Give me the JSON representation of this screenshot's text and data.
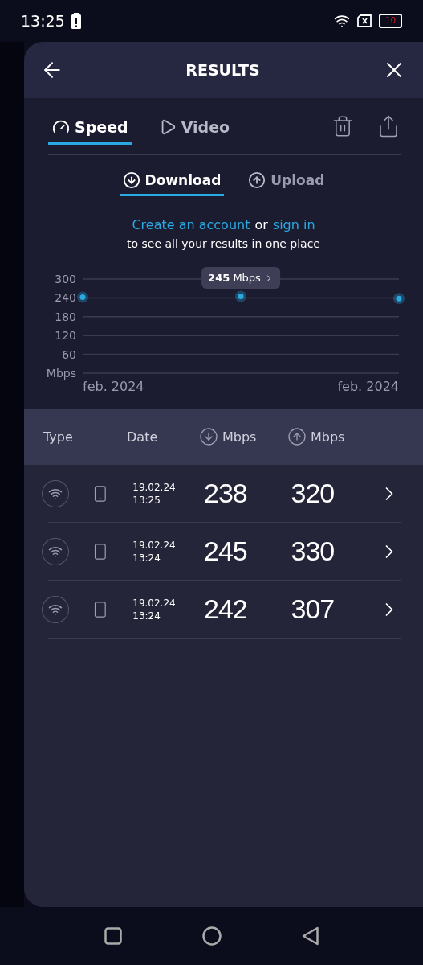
{
  "status_bar": {
    "time": "13:25",
    "battery": "10"
  },
  "header": {
    "title": "RESULTS"
  },
  "tabs": [
    {
      "label": "Speed",
      "kind": "speed",
      "selected": true
    },
    {
      "label": "Video",
      "kind": "video",
      "selected": false
    }
  ],
  "direction_tabs": [
    {
      "label": "Download",
      "kind": "download",
      "selected": true
    },
    {
      "label": "Upload",
      "kind": "upload",
      "selected": false
    }
  ],
  "account_prompt": {
    "create_link": "Create an account",
    "joiner": "or",
    "sign_in_link": "sign in",
    "text": "to see all your results in one place"
  },
  "chart": {
    "chart_data": {
      "type": "scatter",
      "categories": [
        "feb. 2024",
        null,
        "feb. 2024"
      ],
      "series": [
        {
          "color": "#2aa8e0",
          "values": [
            242,
            245,
            238
          ]
        }
      ],
      "grid": true,
      "ylim": [
        0,
        300
      ],
      "yticks": [
        {
          "value": 0,
          "label": "Mbps"
        },
        60,
        120,
        180,
        240,
        300
      ],
      "annotations": [
        "**245** Mbps"
      ]
    }
  },
  "table": {
    "columns": [
      {
        "label": "Type",
        "kind": "text"
      },
      {
        "label": "Date",
        "kind": "text"
      },
      {
        "label": "Mbps",
        "kind": "download"
      },
      {
        "label": "Mbps",
        "kind": "upload"
      }
    ],
    "rows": [
      {
        "date": "19.02.24",
        "time": "13:25",
        "download": "238",
        "upload": "320"
      },
      {
        "date": "19.02.24",
        "time": "13:24",
        "download": "245",
        "upload": "330"
      },
      {
        "date": "19.02.24",
        "time": "13:24",
        "download": "242",
        "upload": "307"
      }
    ]
  }
}
